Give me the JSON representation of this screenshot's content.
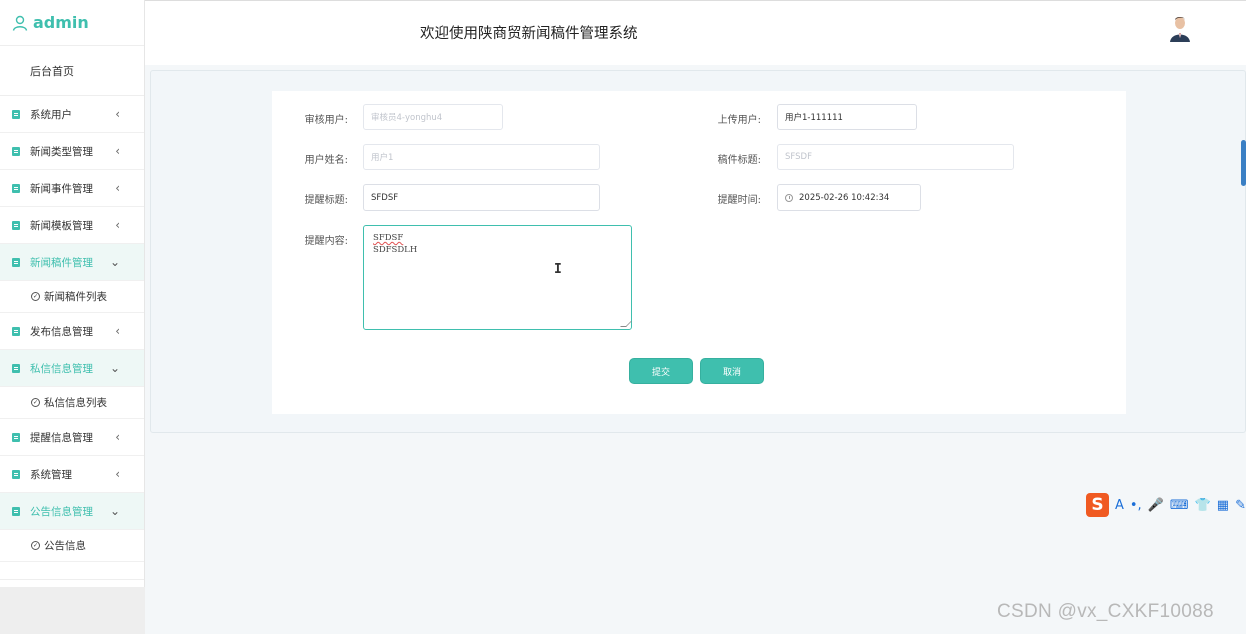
{
  "sidebar": {
    "brand": "admin",
    "home": "后台首页",
    "items": [
      {
        "label": "系统用户",
        "arrow": "‹"
      },
      {
        "label": "新闻类型管理",
        "arrow": "‹"
      },
      {
        "label": "新闻事件管理",
        "arrow": "‹"
      },
      {
        "label": "新闻模板管理",
        "arrow": "‹"
      },
      {
        "label": "新闻稿件管理",
        "arrow": "⌄"
      },
      {
        "label": "新闻稿件列表"
      },
      {
        "label": "发布信息管理",
        "arrow": "‹"
      },
      {
        "label": "私信信息管理",
        "arrow": "⌄"
      },
      {
        "label": "私信信息列表"
      },
      {
        "label": "提醒信息管理",
        "arrow": "‹"
      },
      {
        "label": "系统管理",
        "arrow": "‹"
      },
      {
        "label": "公告信息管理",
        "arrow": "⌄"
      },
      {
        "label": "公告信息"
      }
    ]
  },
  "header": {
    "title": "欢迎使用陕商贸新闻稿件管理系统"
  },
  "form": {
    "reviewer": {
      "label": "审核用户:",
      "placeholder": "审核员4-yonghu4"
    },
    "uploader": {
      "label": "上传用户:",
      "value": "用户1-111111"
    },
    "user_name": {
      "label": "用户姓名:",
      "placeholder": "用户1"
    },
    "manuscript_title": {
      "label": "稿件标题:",
      "placeholder": "SFSDF"
    },
    "reminder_title": {
      "label": "提醒标题:",
      "value": "SFDSF"
    },
    "reminder_time": {
      "label": "提醒时间:",
      "value": "2025-02-26 10:42:34"
    },
    "reminder_content": {
      "label": "提醒内容:",
      "line1": "SFDSF",
      "line2": "SDFSDLH"
    },
    "submit_label": "提交",
    "cancel_label": "取消"
  },
  "ime_toolbar": {
    "logo": "S",
    "items": [
      "A",
      "•,",
      "🎤",
      "⌨",
      "👕",
      "▦",
      "✎"
    ]
  },
  "watermark": "CSDN @vx_CXKF10088",
  "colors": {
    "accent": "#3fbfae",
    "active_bg": "#eef8f6",
    "main_bg": "#f4f7f9"
  }
}
